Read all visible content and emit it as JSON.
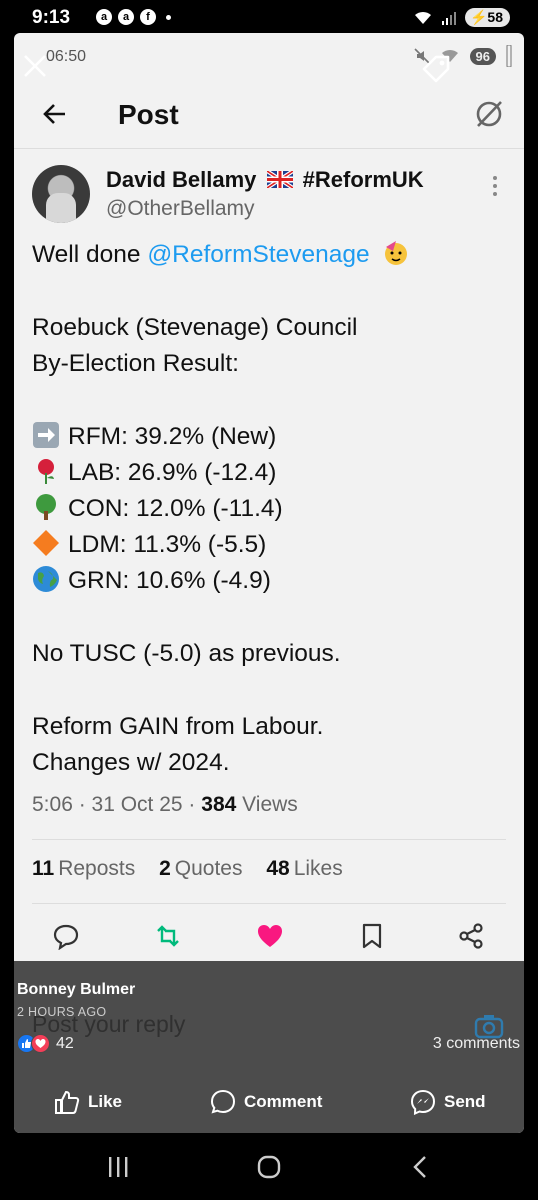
{
  "status_bar": {
    "time": "9:13",
    "battery": "58"
  },
  "inner_status": {
    "time": "06:50",
    "badge": "96"
  },
  "header": {
    "title": "Post"
  },
  "post": {
    "author_name": "David Bellamy",
    "author_tag": "#ReformUK",
    "handle": "@OtherBellamy",
    "lines": {
      "l1_prefix": "Well done ",
      "l1_mention": "@ReformStevenage",
      "l2": "Roebuck (Stevenage) Council",
      "l3": "By-Election Result:",
      "r1": "RFM: 39.2% (New)",
      "r2": "LAB: 26.9% (-12.4)",
      "r3": "CON: 12.0% (-11.4)",
      "r4": "LDM: 11.3% (-5.5)",
      "r5": "GRN: 10.6% (-4.9)",
      "l4": "No TUSC (-5.0) as previous.",
      "l5": "Reform GAIN from Labour.",
      "l6": "Changes w/ 2024."
    },
    "meta": {
      "time_date": "5:06 · 31 Oct 25 · ",
      "views_count": "384",
      "views_label": " Views"
    },
    "stats": {
      "reposts_count": "11",
      "reposts_label": "Reposts",
      "quotes_count": "2",
      "quotes_label": "Quotes",
      "likes_count": "48",
      "likes_label": "Likes"
    },
    "reply_placeholder": "Post your reply"
  },
  "overlay": {
    "name": "Bonney Bulmer",
    "time": "2 HOURS AGO",
    "reaction_count": "42",
    "comments": "3 comments",
    "like_label": "Like",
    "comment_label": "Comment",
    "send_label": "Send"
  },
  "colors": {
    "mention": "#1d9bf0",
    "repost": "#00ba7c",
    "like": "#f91880",
    "overlay": "#464646"
  }
}
